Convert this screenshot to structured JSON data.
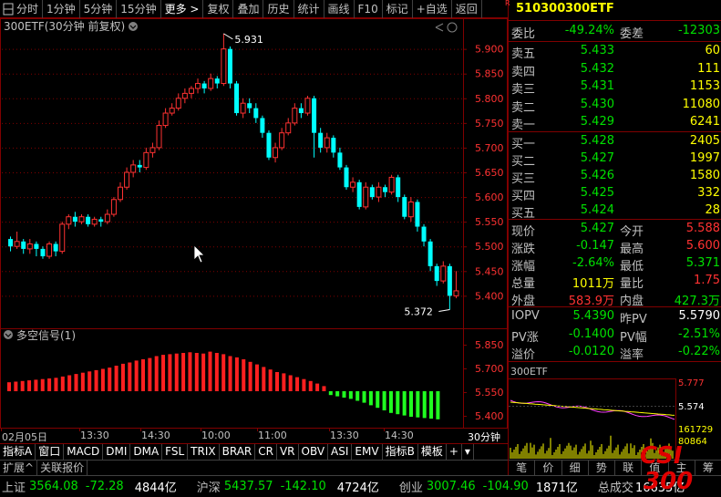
{
  "toolbar": {
    "items": [
      "分时",
      "1分钟",
      "5分钟",
      "15分钟",
      "更多 >",
      "复权",
      "叠加",
      "历史",
      "统计",
      "画线",
      "F10",
      "标记",
      "+自选",
      "返回"
    ]
  },
  "chart": {
    "title": "300ETF(30分钟 前复权)",
    "y_ticks": [
      "5.900",
      "5.850",
      "5.800",
      "5.750",
      "5.700",
      "5.650",
      "5.600",
      "5.550",
      "5.500",
      "5.450",
      "5.400"
    ],
    "high_label": "5.931",
    "low_label": "5.372",
    "x_labels": [
      "02月05日",
      "13:30",
      "14:30",
      "10:00",
      "11:00",
      "13:30",
      "14:30"
    ],
    "period_label": "30分钟"
  },
  "indicator": {
    "title": "多空信号(1)",
    "y_ticks": [
      "5.850",
      "5.700",
      "5.550",
      "5.400"
    ]
  },
  "chart_data": {
    "type": "candlestick",
    "title": "300ETF(30分钟 前复权)",
    "ylim": [
      5.36,
      5.94
    ],
    "candles": [
      [
        5.515,
        5.5,
        5.52,
        5.49
      ],
      [
        5.5,
        5.51,
        5.53,
        5.495
      ],
      [
        5.51,
        5.495,
        5.515,
        5.485
      ],
      [
        5.495,
        5.505,
        5.515,
        5.485
      ],
      [
        5.505,
        5.495,
        5.51,
        5.48
      ],
      [
        5.495,
        5.48,
        5.5,
        5.475
      ],
      [
        5.48,
        5.505,
        5.51,
        5.475
      ],
      [
        5.505,
        5.49,
        5.51,
        5.48
      ],
      [
        5.49,
        5.545,
        5.55,
        5.485
      ],
      [
        5.545,
        5.56,
        5.565,
        5.535
      ],
      [
        5.56,
        5.55,
        5.57,
        5.54
      ],
      [
        5.55,
        5.56,
        5.565,
        5.545
      ],
      [
        5.56,
        5.545,
        5.565,
        5.54
      ],
      [
        5.545,
        5.555,
        5.56,
        5.54
      ],
      [
        5.555,
        5.55,
        5.56,
        5.54
      ],
      [
        5.55,
        5.565,
        5.575,
        5.545
      ],
      [
        5.565,
        5.595,
        5.6,
        5.56
      ],
      [
        5.595,
        5.62,
        5.63,
        5.59
      ],
      [
        5.62,
        5.65,
        5.66,
        5.615
      ],
      [
        5.65,
        5.665,
        5.675,
        5.64
      ],
      [
        5.665,
        5.66,
        5.675,
        5.65
      ],
      [
        5.66,
        5.69,
        5.7,
        5.655
      ],
      [
        5.69,
        5.7,
        5.71,
        5.68
      ],
      [
        5.7,
        5.745,
        5.755,
        5.695
      ],
      [
        5.745,
        5.77,
        5.78,
        5.74
      ],
      [
        5.77,
        5.78,
        5.79,
        5.765
      ],
      [
        5.78,
        5.8,
        5.81,
        5.775
      ],
      [
        5.8,
        5.81,
        5.82,
        5.79
      ],
      [
        5.81,
        5.82,
        5.825,
        5.8
      ],
      [
        5.82,
        5.83,
        5.84,
        5.81
      ],
      [
        5.83,
        5.82,
        5.835,
        5.81
      ],
      [
        5.82,
        5.84,
        5.85,
        5.815
      ],
      [
        5.84,
        5.83,
        5.845,
        5.82
      ],
      [
        5.83,
        5.9,
        5.931,
        5.825
      ],
      [
        5.9,
        5.83,
        5.905,
        5.82
      ],
      [
        5.83,
        5.77,
        5.835,
        5.765
      ],
      [
        5.77,
        5.79,
        5.8,
        5.76
      ],
      [
        5.79,
        5.78,
        5.8,
        5.77
      ],
      [
        5.78,
        5.76,
        5.79,
        5.75
      ],
      [
        5.76,
        5.73,
        5.765,
        5.72
      ],
      [
        5.73,
        5.68,
        5.735,
        5.675
      ],
      [
        5.68,
        5.7,
        5.71,
        5.67
      ],
      [
        5.7,
        5.73,
        5.74,
        5.695
      ],
      [
        5.73,
        5.75,
        5.76,
        5.725
      ],
      [
        5.75,
        5.78,
        5.79,
        5.745
      ],
      [
        5.78,
        5.77,
        5.79,
        5.76
      ],
      [
        5.77,
        5.8,
        5.805,
        5.765
      ],
      [
        5.8,
        5.73,
        5.805,
        5.68
      ],
      [
        5.73,
        5.7,
        5.74,
        5.69
      ],
      [
        5.7,
        5.72,
        5.73,
        5.69
      ],
      [
        5.72,
        5.69,
        5.725,
        5.68
      ],
      [
        5.69,
        5.66,
        5.7,
        5.655
      ],
      [
        5.66,
        5.62,
        5.665,
        5.615
      ],
      [
        5.62,
        5.63,
        5.64,
        5.61
      ],
      [
        5.63,
        5.58,
        5.635,
        5.575
      ],
      [
        5.58,
        5.62,
        5.63,
        5.575
      ],
      [
        5.62,
        5.6,
        5.625,
        5.595
      ],
      [
        5.6,
        5.62,
        5.63,
        5.59
      ],
      [
        5.62,
        5.61,
        5.625,
        5.6
      ],
      [
        5.61,
        5.64,
        5.645,
        5.605
      ],
      [
        5.64,
        5.6,
        5.645,
        5.59
      ],
      [
        5.6,
        5.56,
        5.605,
        5.555
      ],
      [
        5.56,
        5.59,
        5.6,
        5.55
      ],
      [
        5.59,
        5.54,
        5.595,
        5.53
      ],
      [
        5.54,
        5.51,
        5.545,
        5.5
      ],
      [
        5.51,
        5.46,
        5.515,
        5.45
      ],
      [
        5.46,
        5.43,
        5.465,
        5.42
      ],
      [
        5.43,
        5.46,
        5.47,
        5.425
      ],
      [
        5.46,
        5.4,
        5.465,
        5.372
      ],
      [
        5.4,
        5.41,
        5.45,
        5.395
      ]
    ],
    "signal_values": [
      0.14,
      0.15,
      0.16,
      0.17,
      0.18,
      0.19,
      0.2,
      0.21,
      0.23,
      0.25,
      0.27,
      0.29,
      0.31,
      0.33,
      0.35,
      0.37,
      0.4,
      0.43,
      0.45,
      0.48,
      0.5,
      0.52,
      0.55,
      0.57,
      0.58,
      0.59,
      0.6,
      0.61,
      0.6,
      0.59,
      0.62,
      0.6,
      0.58,
      0.55,
      0.53,
      0.5,
      0.46,
      0.42,
      0.38,
      0.34,
      0.3,
      0.28,
      0.25,
      0.22,
      0.19,
      0.16,
      0.12,
      0.08,
      -0.06,
      -0.08,
      -0.1,
      -0.12,
      -0.15,
      -0.18,
      -0.22,
      -0.26,
      -0.3,
      -0.34,
      -0.36,
      -0.38,
      -0.4,
      -0.41,
      -0.42,
      -0.43,
      -0.44
    ]
  },
  "right_panel": {
    "code": "510300",
    "name": "300ETF",
    "weibi_label": "委比",
    "weibi": "-49.24%",
    "weicha_label": "委差",
    "weicha": "-12303",
    "asks": [
      {
        "label": "卖五",
        "price": "5.433",
        "vol": "60"
      },
      {
        "label": "卖四",
        "price": "5.432",
        "vol": "111"
      },
      {
        "label": "卖三",
        "price": "5.431",
        "vol": "1153"
      },
      {
        "label": "卖二",
        "price": "5.430",
        "vol": "11080"
      },
      {
        "label": "卖一",
        "price": "5.429",
        "vol": "6241"
      }
    ],
    "bids": [
      {
        "label": "买一",
        "price": "5.428",
        "vol": "2405"
      },
      {
        "label": "买二",
        "price": "5.427",
        "vol": "1997"
      },
      {
        "label": "买三",
        "price": "5.426",
        "vol": "1580"
      },
      {
        "label": "买四",
        "price": "5.425",
        "vol": "332"
      },
      {
        "label": "买五",
        "price": "5.424",
        "vol": "28"
      }
    ],
    "quote": [
      {
        "l1": "现价",
        "v1": "5.427",
        "l2": "今开",
        "v2": "5.588"
      },
      {
        "l1": "涨跌",
        "v1": "-0.147",
        "l2": "最高",
        "v2": "5.600"
      },
      {
        "l1": "涨幅",
        "v1": "-2.64%",
        "l2": "最低",
        "v2": "5.371"
      },
      {
        "l1": "总量",
        "v1": "1011万",
        "l2": "量比",
        "v2": "1.75"
      },
      {
        "l1": "外盘",
        "v1": "583.9万",
        "l2": "内盘",
        "v2": "427.3万"
      }
    ],
    "iopv": [
      {
        "l1": "IOPV",
        "v1": "5.4390",
        "l2": "昨PV",
        "v2": "5.5790"
      },
      {
        "l1": "PV涨",
        "v1": "-0.1400",
        "l2": "PV幅",
        "v2": "-2.51%"
      },
      {
        "l1": "溢价",
        "v1": "-0.0120",
        "l2": "溢率",
        "v2": "-0.22%"
      }
    ],
    "mini_title": "300ETF",
    "mini_labels": [
      "5.777",
      "5.574",
      "161729",
      "80864"
    ],
    "buttons": [
      "笔",
      "价",
      "细",
      "势",
      "联",
      "值",
      "主",
      "筹"
    ]
  },
  "status": {
    "sh_label": "上证",
    "sh_val": "3564.08",
    "sh_chg": "-72.28",
    "sh_amt": "4844亿",
    "hs_label": "沪深",
    "hs_val": "5437.57",
    "hs_chg": "-142.10",
    "hs_amt": "4724亿",
    "cy_label": "创业",
    "cy_val": "3007.46",
    "cy_chg": "-104.90",
    "cy_amt": "1871亿",
    "total_label": "总成交",
    "total_val": "16635亿"
  },
  "indicator_tabs": [
    "指标A",
    "窗口",
    "MACD",
    "DMI",
    "DMA",
    "FSL",
    "TRIX",
    "BRAR",
    "CR",
    "VR",
    "OBV",
    "ASI",
    "EMV",
    "指标B",
    "模板"
  ],
  "ext_tabs": [
    "扩展^",
    "关联报价"
  ],
  "logo_text": "CSI 300"
}
